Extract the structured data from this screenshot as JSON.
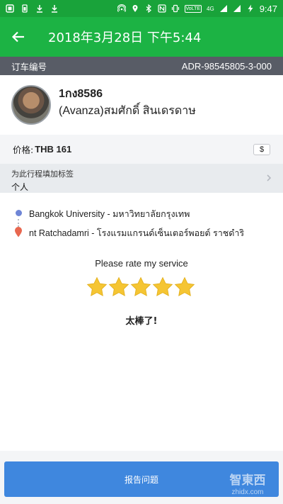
{
  "status_bar": {
    "time": "9:47",
    "network": "4G",
    "volte": "VoLTE",
    "icons_left": [
      "notification-square-icon",
      "battery-icon",
      "download-icon",
      "download-icon"
    ],
    "icons_right": [
      "hotspot-icon",
      "location-icon",
      "bluetooth-icon",
      "nfc-icon",
      "vibrate-icon",
      "signal-icon",
      "signal-icon",
      "charging-icon"
    ]
  },
  "app_bar": {
    "title": "2018年3月28日 下午5:44"
  },
  "order": {
    "label": "订车编号",
    "value": "ADR-98545805-3-000"
  },
  "driver": {
    "plate": "1กง8586",
    "name": "(Avanza)สมศักดิ์ สินเดรดาษ"
  },
  "price": {
    "label": "价格:",
    "value": "THB 161",
    "receipt_button_label": "$"
  },
  "tag": {
    "label": "为此行程填加标签",
    "value": "个人"
  },
  "route": {
    "pickup": "Bangkok University - มหาวิทยาลัยกรุงเทพ",
    "dropoff": "nt Ratchadamri - โรงแรมแกรนด์เซ็นเตอร์พอยต์ ราชดำริ"
  },
  "rating": {
    "prompt": "Please rate my service",
    "stars": 5,
    "max_stars": 5,
    "result": "太棒了!"
  },
  "report_button_label": "报告问题",
  "watermark": {
    "text_cn": "智東西",
    "text_en": "zhidx.com"
  },
  "colors": {
    "status_bar": "#19a33a",
    "app_bar": "#1cb344",
    "order_bar": "#585c66",
    "star": "#f5c533",
    "button": "#3f87de",
    "pickup_dot": "#6f86d6",
    "dropoff_pin": "#e8674f"
  }
}
